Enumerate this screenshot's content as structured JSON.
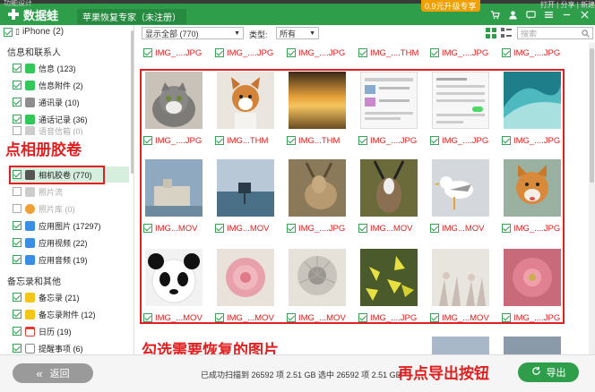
{
  "titlebar": {
    "app_name": "数据蛙",
    "app_subtitle": "苹果恢复专家（未注册）",
    "promo": "0.9元升级专享",
    "icons": [
      "cart-icon",
      "user-icon",
      "feedback-icon",
      "menu-icon",
      "minimize-icon",
      "close-icon"
    ],
    "bg_left": "功能设计",
    "bg_right": "打开 | 分享 | 新建"
  },
  "sidebar": {
    "device": "iPhone (2)",
    "groups": [
      {
        "label": "信息和联系人",
        "items": [
          {
            "label": "信息 (123)",
            "icon": "message-icon",
            "color": "#34c759",
            "checked": true
          },
          {
            "label": "信息附件 (2)",
            "icon": "message-attach-icon",
            "color": "#34c759",
            "checked": true
          },
          {
            "label": "通讯录 (10)",
            "icon": "contacts-icon",
            "color": "#8e8e8e",
            "checked": true
          },
          {
            "label": "通话记录 (36)",
            "icon": "phone-icon",
            "color": "#34c759",
            "checked": true
          },
          {
            "label": "语音信箱 (0)",
            "icon": "voicemail-icon",
            "color": "#aaaaaa",
            "checked": false
          }
        ]
      },
      {
        "label": "照片和视频",
        "items": [
          {
            "label": "相机胶卷 (770)",
            "icon": "camera-icon",
            "color": "#555555",
            "checked": true,
            "selected": true
          },
          {
            "label": "照片流",
            "icon": "photostream-icon",
            "color": "#aaaaaa",
            "checked": false
          },
          {
            "label": "照片库 (0)",
            "icon": "photos-icon",
            "color": "#f0a030",
            "checked": false
          },
          {
            "label": "应用图片 (17297)",
            "icon": "app-photo-icon",
            "color": "#3a8ee6",
            "checked": true
          },
          {
            "label": "应用视频 (22)",
            "icon": "app-video-icon",
            "color": "#3a8ee6",
            "checked": true
          },
          {
            "label": "应用音频 (19)",
            "icon": "app-audio-icon",
            "color": "#3a8ee6",
            "checked": true
          }
        ]
      },
      {
        "label": "备忘录和其他",
        "items": [
          {
            "label": "备忘录 (21)",
            "icon": "notes-icon",
            "color": "#f5c518",
            "checked": true
          },
          {
            "label": "备忘录附件 (12)",
            "icon": "notes-attach-icon",
            "color": "#f5c518",
            "checked": true
          },
          {
            "label": "日历 (19)",
            "icon": "calendar-icon",
            "color": "#e53935",
            "checked": true
          },
          {
            "label": "提醒事项 (6)",
            "icon": "reminder-icon",
            "color": "#888888",
            "checked": true
          }
        ]
      }
    ]
  },
  "toolbar": {
    "filter_value": "显示全部 (770)",
    "type_label": "类型:",
    "type_value": "所有",
    "search_placeholder": "搜索"
  },
  "grid": {
    "rows": [
      {
        "labels": [
          "IMG_....JPG",
          "IMG_....JPG",
          "IMG_....JPG",
          "IMG_....THM",
          "IMG_....JPG",
          "IMG_....JPG"
        ],
        "thumbs": [
          "cat",
          "corgi",
          "sunset",
          "screenshot-a",
          "screenshot-b",
          "wave"
        ]
      },
      {
        "labels": [
          "IMG_....JPG",
          "IMG...THM",
          "IMG...THM",
          "IMG_....JPG",
          "IMG_....JPG",
          "IMG_....JPG"
        ],
        "thumbs": [
          "building",
          "pier",
          "deer",
          "antelope",
          "seagull",
          "shiba"
        ]
      },
      {
        "labels": [
          "IMG...MOV",
          "IMG...MOV",
          "IMG_....JPG",
          "IMG...MOV",
          "IMG...MOV",
          "IMG_....JPG"
        ],
        "thumbs": [
          "panda",
          "pink-flower",
          "dandelion",
          "yellow-leaves",
          "pale-flowers",
          "red-flower"
        ]
      },
      {
        "labels": [
          "IMG_...MOV",
          "IMG_...MOV",
          "IMG_...MOV",
          "IMG_....JPG",
          "IMG_...MOV",
          "IMG_....JPG"
        ],
        "thumbs": [
          "blank",
          "blank",
          "blank",
          "blank",
          "blank",
          "blank"
        ]
      }
    ]
  },
  "annotations": {
    "click_album": "点相册胶卷",
    "select_photos": "勾选需要恢复的图片",
    "click_export": "再点导出按钮"
  },
  "footer": {
    "back_label": "返回",
    "status": "已成功扫描到 26592 项 2.51 GB   选中 26592 项 2.51 GB",
    "export_label": "导出"
  },
  "colors": {
    "brand": "#2e9e4b",
    "annotation": "#e02020"
  }
}
